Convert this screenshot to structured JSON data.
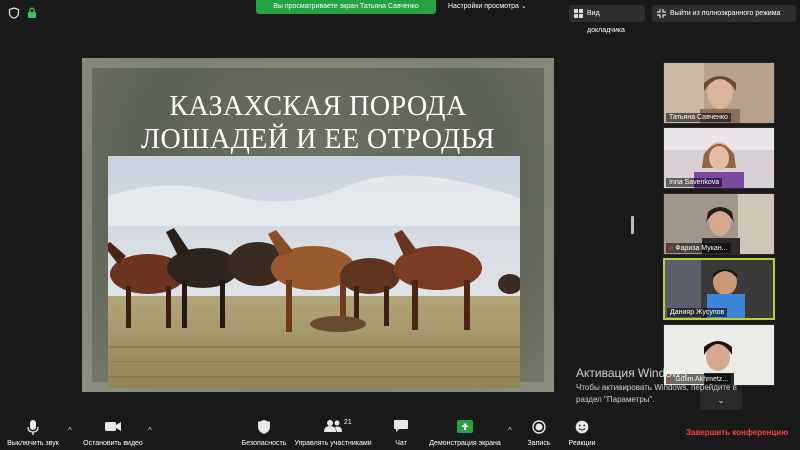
{
  "topbar": {
    "share_notice": "Вы просматриваете экран Татьяна Савченко",
    "view_options": "Настройки просмотра ⌄",
    "speaker_view": "Вид докладчика",
    "exit_fullscreen": "Выйти из полноэкранного режима"
  },
  "slide": {
    "title_line1": "КАЗАХСКАЯ ПОРОДА",
    "title_line2": "ЛОШАДЕЙ И ЕЕ ОТРОДЬЯ"
  },
  "participants": [
    {
      "name": "Татьяна Савченко",
      "muted": false
    },
    {
      "name": "Inna Savenkova",
      "muted": false
    },
    {
      "name": "Фариза Мукан...",
      "muted": true
    },
    {
      "name": "Данияр Жусупов",
      "muted": false,
      "active": true
    },
    {
      "name": "Gulim Akhmetz...",
      "muted": true
    }
  ],
  "watermark": {
    "line1": "Активация Windows",
    "line2": "Чтобы активировать Windows, перейдите в",
    "line3": "раздел \"Параметры\"."
  },
  "toolbar": {
    "mute": "Выключить звук",
    "stop_video": "Остановить видео",
    "security": "Безопасность",
    "participants": "Управлять участниками",
    "participants_count": "21",
    "chat": "Чат",
    "share_screen": "Демонстрация экрана",
    "record": "Запись",
    "reactions": "Реакции",
    "end_meeting": "Завершить конференцию"
  },
  "colors": {
    "share_green": "#25a244",
    "active_speaker": "#b8d12f",
    "end_red": "#f0473b"
  }
}
